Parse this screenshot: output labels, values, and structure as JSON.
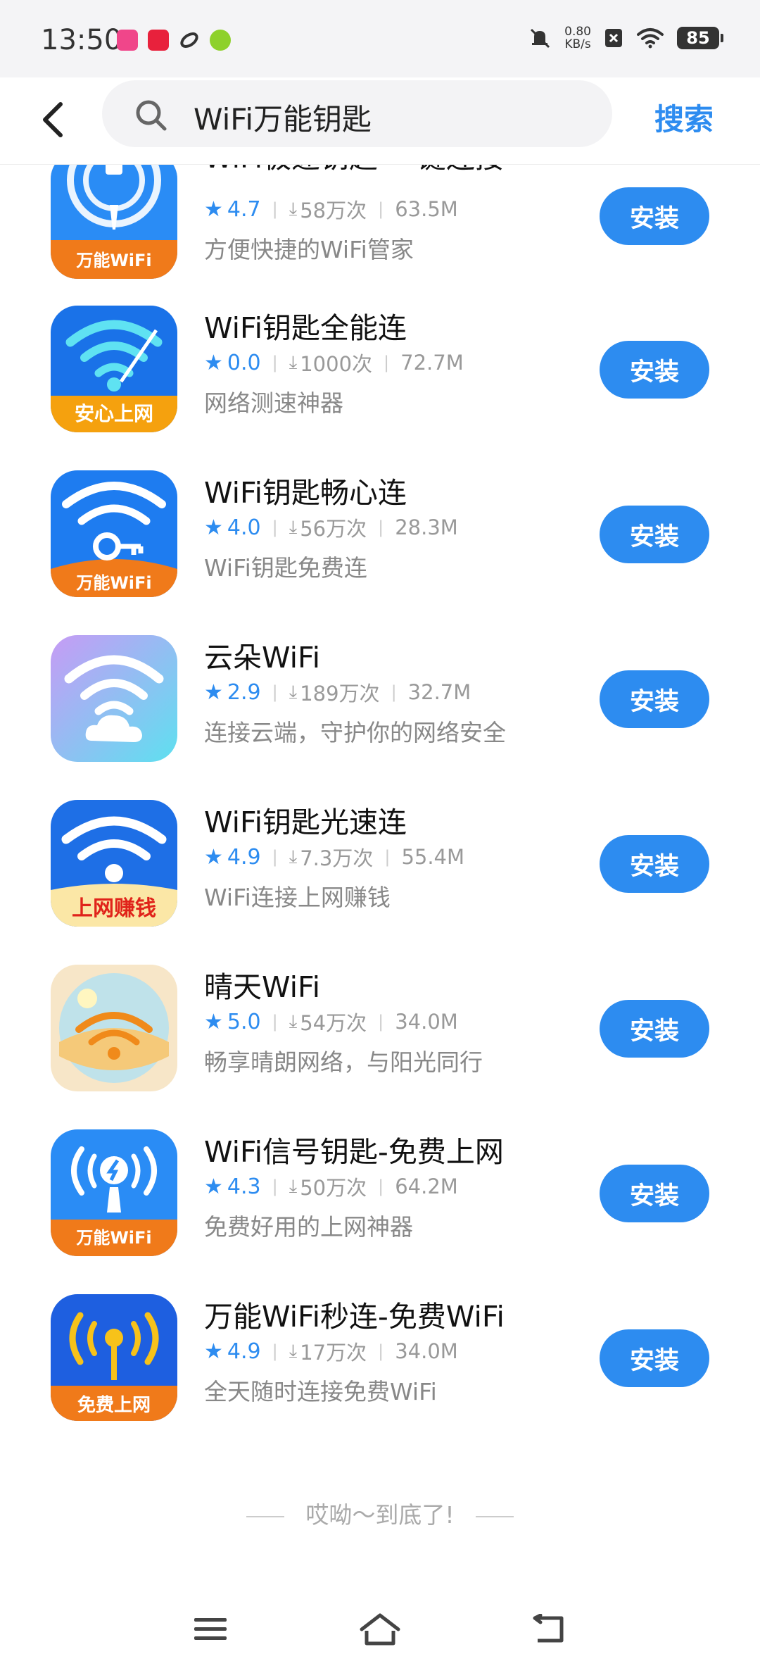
{
  "status_bar": {
    "time": "13:50",
    "net_speed_value": "0.80",
    "net_speed_unit": "KB/s",
    "battery": "85",
    "notification_icons": [
      "lalu-app-icon",
      "xiaohongshu-icon",
      "link-app-icon",
      "green-app-icon"
    ]
  },
  "header": {
    "search_query": "WiFi万能钥匙",
    "search_button": "搜索"
  },
  "install_label": "安装",
  "colors": {
    "accent": "#2d8cf0"
  },
  "apps": [
    {
      "name": "WiFi极速钥匙-一键连接",
      "rating": "4.7",
      "downloads": "58万次",
      "size": "63.5M",
      "desc": "方便快捷的WiFi管家",
      "icon_label": "万能WiFi"
    },
    {
      "name": "WiFi钥匙全能连",
      "rating": "0.0",
      "downloads": "1000次",
      "size": "72.7M",
      "desc": "网络测速神器",
      "icon_label": "安心上网"
    },
    {
      "name": "WiFi钥匙畅心连",
      "rating": "4.0",
      "downloads": "56万次",
      "size": "28.3M",
      "desc": "WiFi钥匙免费连",
      "icon_label": "万能WiFi"
    },
    {
      "name": "云朵WiFi",
      "rating": "2.9",
      "downloads": "189万次",
      "size": "32.7M",
      "desc": "连接云端，守护你的网络安全",
      "icon_label": ""
    },
    {
      "name": "WiFi钥匙光速连",
      "rating": "4.9",
      "downloads": "7.3万次",
      "size": "55.4M",
      "desc": "WiFi连接上网赚钱",
      "icon_label": "上网赚钱"
    },
    {
      "name": "晴天WiFi",
      "rating": "5.0",
      "downloads": "54万次",
      "size": "34.0M",
      "desc": "畅享晴朗网络，与阳光同行",
      "icon_label": ""
    },
    {
      "name": "WiFi信号钥匙-免费上网",
      "rating": "4.3",
      "downloads": "50万次",
      "size": "64.2M",
      "desc": "免费好用的上网神器",
      "icon_label": "万能WiFi"
    },
    {
      "name": "万能WiFi秒连-免费WiFi",
      "rating": "4.9",
      "downloads": "17万次",
      "size": "34.0M",
      "desc": "全天随时连接免费WiFi",
      "icon_label": "免费上网"
    }
  ],
  "end_text": "哎呦～到底了!"
}
